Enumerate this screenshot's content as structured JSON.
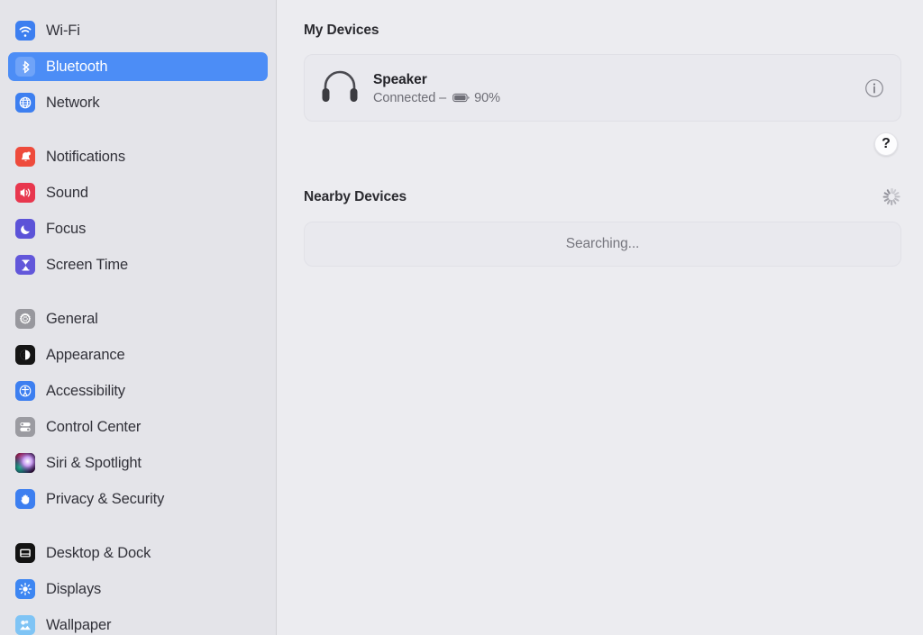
{
  "sidebar": {
    "groups": [
      {
        "items": [
          {
            "label": "Wi-Fi",
            "icon": "wifi-icon",
            "selected": false
          },
          {
            "label": "Bluetooth",
            "icon": "bluetooth-icon",
            "selected": true
          },
          {
            "label": "Network",
            "icon": "network-globe-icon",
            "selected": false
          }
        ]
      },
      {
        "items": [
          {
            "label": "Notifications",
            "icon": "notifications-bell-icon",
            "selected": false
          },
          {
            "label": "Sound",
            "icon": "sound-speaker-icon",
            "selected": false
          },
          {
            "label": "Focus",
            "icon": "focus-moon-icon",
            "selected": false
          },
          {
            "label": "Screen Time",
            "icon": "screen-time-hourglass-icon",
            "selected": false
          }
        ]
      },
      {
        "items": [
          {
            "label": "General",
            "icon": "general-gear-icon",
            "selected": false
          },
          {
            "label": "Appearance",
            "icon": "appearance-contrast-icon",
            "selected": false
          },
          {
            "label": "Accessibility",
            "icon": "accessibility-icon",
            "selected": false
          },
          {
            "label": "Control Center",
            "icon": "control-center-icon",
            "selected": false
          },
          {
            "label": "Siri & Spotlight",
            "icon": "siri-orb-icon",
            "selected": false
          },
          {
            "label": "Privacy & Security",
            "icon": "privacy-hand-icon",
            "selected": false
          }
        ]
      },
      {
        "items": [
          {
            "label": "Desktop & Dock",
            "icon": "desktop-dock-icon",
            "selected": false
          },
          {
            "label": "Displays",
            "icon": "displays-sun-icon",
            "selected": false
          },
          {
            "label": "Wallpaper",
            "icon": "wallpaper-icon",
            "selected": false
          }
        ]
      }
    ]
  },
  "main": {
    "my_devices": {
      "title": "My Devices",
      "device": {
        "icon": "headphones-icon",
        "name": "Speaker",
        "status_prefix": "Connected –",
        "battery_icon": "battery-icon",
        "battery_level": "90%",
        "info_icon": "info-circle-icon"
      }
    },
    "help_button_label": "?",
    "nearby_devices": {
      "title": "Nearby Devices",
      "spinner_icon": "loading-spinner-icon",
      "searching_label": "Searching..."
    }
  },
  "colors": {
    "accent_blue": "#4C8DF6",
    "sidebar_bg": "#E4E4E9",
    "main_bg": "#ECECF0",
    "card_bg": "#E9E9EE"
  }
}
